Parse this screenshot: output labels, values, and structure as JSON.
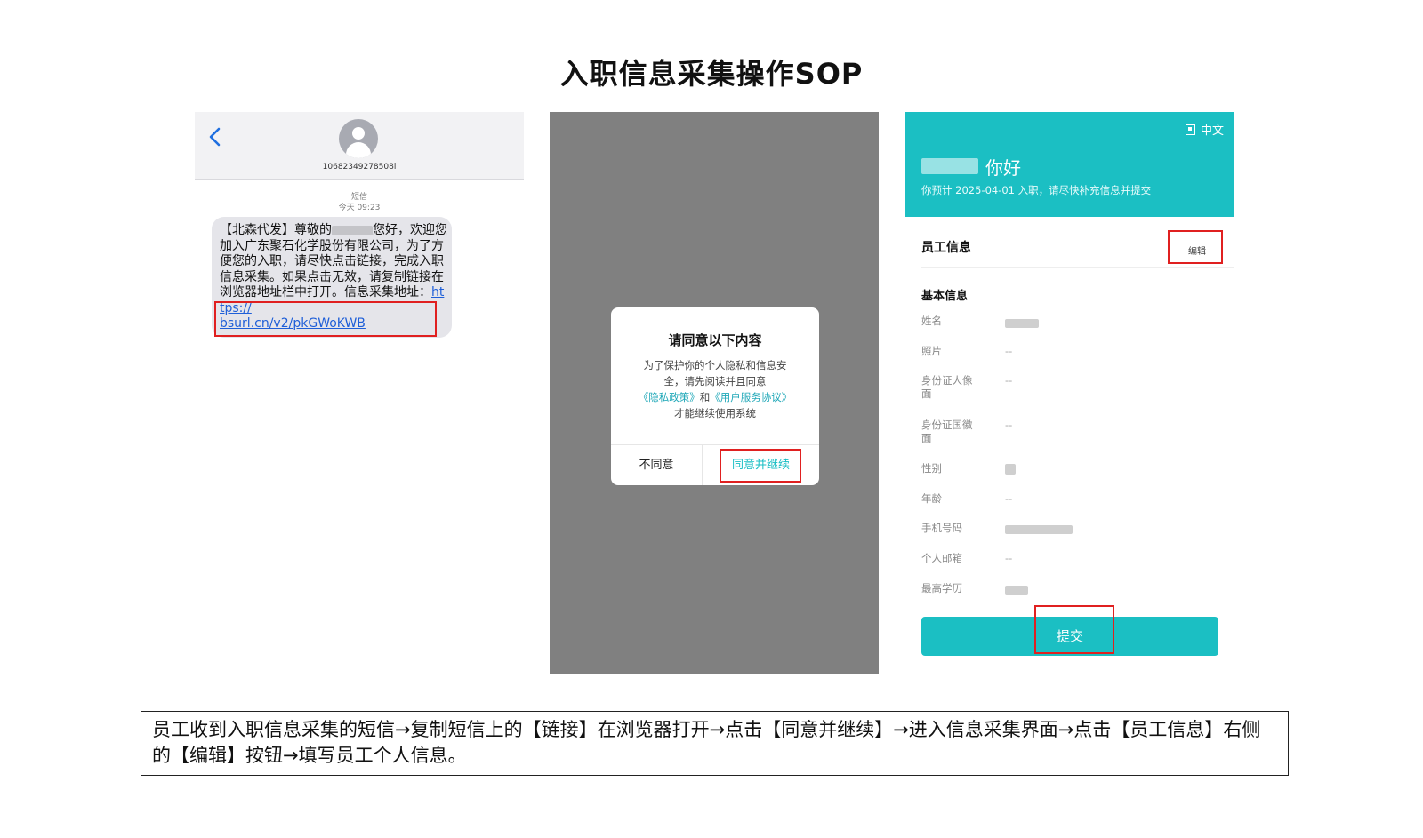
{
  "title": "入职信息采集操作SOP",
  "sms": {
    "sender_number": "10682349278508l",
    "type_label": "短信",
    "time": "今天 09:23",
    "message_before_name": "【北森代发】尊敬的",
    "message_after_name": "您好，欢迎您加入广东聚石化学股份有限公司，为了方便您的入职，请尽快点击链接，完成入职信息采集。如果点击无效，请复制链接在浏览器地址栏中打开。信息采集地址：",
    "link_part1": "https://",
    "link_part2": "bsurl.cn/v2/pkGWoKWB"
  },
  "dialog": {
    "title": "请同意以下内容",
    "body_before": "为了保护你的个人隐私和信息安全，请先阅读并且同意",
    "privacy_link": "《隐私政策》",
    "and_text": "和",
    "terms_link": "《用户服务协议》",
    "body_after": "才能继续使用系统",
    "disagree_label": "不同意",
    "agree_label": "同意并继续"
  },
  "form": {
    "language": "中文",
    "greeting": "你好",
    "subtitle": "你预计 2025-04-01 入职，请尽快补充信息并提交",
    "section_title": "员工信息",
    "edit_label": "编辑",
    "basic_info_title": "基本信息",
    "fields": [
      {
        "label": "姓名",
        "value": ""
      },
      {
        "label": "照片",
        "value": "--"
      },
      {
        "label": "身份证人像面",
        "value": "--"
      },
      {
        "label": "身份证国徽面",
        "value": "--"
      },
      {
        "label": "性别",
        "value": ""
      },
      {
        "label": "年龄",
        "value": "--"
      },
      {
        "label": "手机号码",
        "value": ""
      },
      {
        "label": "个人邮箱",
        "value": "--"
      },
      {
        "label": "最高学历",
        "value": ""
      }
    ],
    "submit_label": "提交"
  },
  "caption": "员工收到入职信息采集的短信→复制短信上的【链接】在浏览器打开→点击【同意并继续】→进入信息采集界面→点击【员工信息】右侧的【编辑】按钮→填写员工个人信息。",
  "colors": {
    "accent_teal": "#1bbfc3",
    "highlight_red": "#e02020",
    "link_blue": "#1f5fd8",
    "overlay_gray": "#808080"
  }
}
